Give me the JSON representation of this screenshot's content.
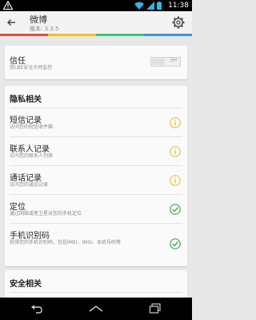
{
  "status_bar": {
    "time": "11:38"
  },
  "app_bar": {
    "title": "微博",
    "subtitle": "版本: 3.3.5"
  },
  "colors": {
    "strip": [
      "#e74c3c",
      "#f1c40f",
      "#2ecc71",
      "#3498db"
    ],
    "warning": "#e3c540",
    "ok": "#3fa74a"
  },
  "trust": {
    "label": "信任",
    "desc": "受LBE安全大师监控",
    "toggle_text": "OFF"
  },
  "privacy": {
    "title": "隐私相关",
    "items": [
      {
        "label": "短信记录",
        "desc": "访问您的短信收件箱",
        "status": "warning"
      },
      {
        "label": "联系人记录",
        "desc": "访问您的联系人列表",
        "status": "warning"
      },
      {
        "label": "通话记录",
        "desc": "访问您的通话记录",
        "status": "warning"
      },
      {
        "label": "定位",
        "desc": "通过网络或者卫星对您的手机定位",
        "status": "ok"
      },
      {
        "label": "手机识别码",
        "desc": "获得您的手机识别码，包括IMEI，IMSI，本机号码等",
        "status": "ok"
      }
    ]
  },
  "security": {
    "title": "安全相关"
  }
}
